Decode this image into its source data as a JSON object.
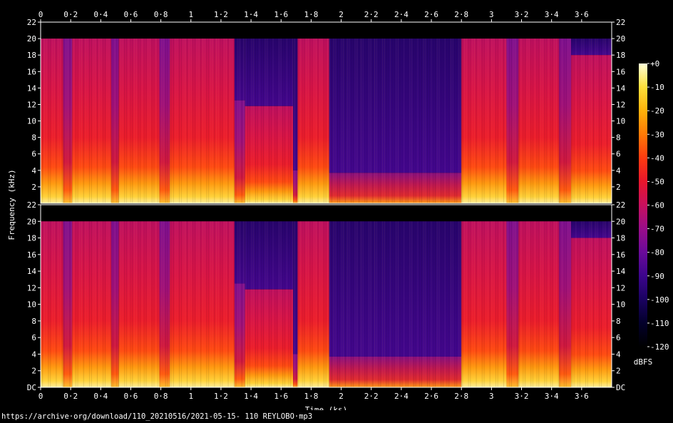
{
  "chart_data": {
    "type": "heatmap",
    "subtype": "spectrogram",
    "channels": 2,
    "xlabel": "Time (ks)",
    "ylabel": "Frequency (kHz)",
    "xlim": [
      0,
      3.8
    ],
    "ylim": [
      0,
      22
    ],
    "x_ticks": [
      "0",
      "0·2",
      "0·4",
      "0·6",
      "0·8",
      "1",
      "1·2",
      "1·4",
      "1·6",
      "1·8",
      "2",
      "2·2",
      "2·4",
      "2·6",
      "2·8",
      "3",
      "3·2",
      "3·4",
      "3·6"
    ],
    "x_tick_values": [
      0,
      0.2,
      0.4,
      0.6,
      0.8,
      1.0,
      1.2,
      1.4,
      1.6,
      1.8,
      2.0,
      2.2,
      2.4,
      2.6,
      2.8,
      3.0,
      3.2,
      3.4,
      3.6
    ],
    "y_ticks_top": [
      "22",
      "20",
      "18",
      "16",
      "14",
      "12",
      "10",
      "8",
      "6",
      "4",
      "2"
    ],
    "y_tick_values_top": [
      22,
      20,
      18,
      16,
      14,
      12,
      10,
      8,
      6,
      4,
      2
    ],
    "y_ticks_bottom": [
      "22",
      "20",
      "18",
      "16",
      "14",
      "12",
      "10",
      "8",
      "6",
      "4",
      "2",
      "DC"
    ],
    "y_tick_values_bottom": [
      22,
      20,
      18,
      16,
      14,
      12,
      10,
      8,
      6,
      4,
      2,
      0
    ],
    "colorbar": {
      "label": "dBFS",
      "ticks": [
        "+0",
        "-10",
        "-20",
        "-30",
        "-40",
        "-50",
        "-60",
        "-70",
        "-80",
        "-90",
        "-100",
        "-110",
        "-120"
      ],
      "tick_values": [
        0,
        -10,
        -20,
        -30,
        -40,
        -50,
        -60,
        -70,
        -80,
        -90,
        -100,
        -110,
        -120
      ],
      "range": [
        -120,
        0
      ]
    },
    "segments": [
      {
        "start": 0.0,
        "end": 0.15,
        "cutoff_khz": 20.0,
        "level": "loud"
      },
      {
        "start": 0.15,
        "end": 0.21,
        "cutoff_khz": 20.0,
        "level": "medium"
      },
      {
        "start": 0.21,
        "end": 0.47,
        "cutoff_khz": 20.0,
        "level": "loud"
      },
      {
        "start": 0.47,
        "end": 0.52,
        "cutoff_khz": 20.0,
        "level": "medium"
      },
      {
        "start": 0.52,
        "end": 0.79,
        "cutoff_khz": 20.0,
        "level": "loud"
      },
      {
        "start": 0.79,
        "end": 0.86,
        "cutoff_khz": 20.0,
        "level": "medium"
      },
      {
        "start": 0.86,
        "end": 1.29,
        "cutoff_khz": 20.0,
        "level": "loud"
      },
      {
        "start": 1.29,
        "end": 1.36,
        "cutoff_khz": 12.5,
        "level": "medium"
      },
      {
        "start": 1.36,
        "end": 1.68,
        "cutoff_khz": 11.8,
        "level": "loud"
      },
      {
        "start": 1.68,
        "end": 1.71,
        "cutoff_khz": 4.0,
        "level": "medium"
      },
      {
        "start": 1.71,
        "end": 1.92,
        "cutoff_khz": 20.0,
        "level": "loud"
      },
      {
        "start": 1.92,
        "end": 2.8,
        "cutoff_khz": 3.7,
        "level": "quiet"
      },
      {
        "start": 2.8,
        "end": 3.1,
        "cutoff_khz": 20.0,
        "level": "loud"
      },
      {
        "start": 3.1,
        "end": 3.18,
        "cutoff_khz": 20.0,
        "level": "medium"
      },
      {
        "start": 3.18,
        "end": 3.45,
        "cutoff_khz": 20.0,
        "level": "loud"
      },
      {
        "start": 3.45,
        "end": 3.53,
        "cutoff_khz": 20.0,
        "level": "medium"
      },
      {
        "start": 3.53,
        "end": 3.8,
        "cutoff_khz": 18.0,
        "level": "loud"
      }
    ],
    "colors": {
      "background": "#000000",
      "colormap": [
        "#000000",
        "#03002b",
        "#1a0260",
        "#3c058d",
        "#6a0a9a",
        "#9a0d8a",
        "#c8105e",
        "#e8162c",
        "#ff3b10",
        "#ff7a06",
        "#ffb20a",
        "#ffe03a",
        "#ffffd8"
      ]
    }
  },
  "footer": {
    "source_url": "https://archive·org/download/110_20210516/2021-05-15- 110 REYLOBO·mp3"
  }
}
